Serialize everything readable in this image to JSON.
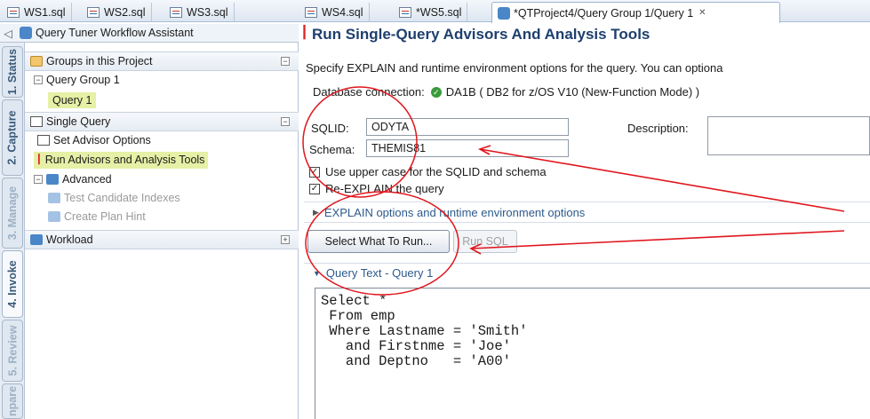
{
  "tabs": [
    {
      "label": "WS1.sql"
    },
    {
      "label": "WS2.sql"
    },
    {
      "label": "WS3.sql"
    },
    {
      "label": "WS4.sql"
    },
    {
      "label": "*WS5.sql"
    },
    {
      "label": "*QTProject4/Query Group 1/Query 1"
    }
  ],
  "side_tabs": [
    "1. Status",
    "2. Capture",
    "3. Manage",
    "4. Invoke",
    "5. Review",
    "npare"
  ],
  "assistant": {
    "title": "Query Tuner Workflow Assistant",
    "groups_section": "Groups in this Project",
    "group_item": "Query Group 1",
    "query_item": "Query 1",
    "single_query_section": "Single Query",
    "set_advisor": "Set Advisor Options",
    "run_advisors": "Run Advisors and Analysis Tools",
    "advanced": "Advanced",
    "test_indexes": "Test Candidate Indexes",
    "plan_hint": "Create Plan Hint",
    "workload": "Workload"
  },
  "main": {
    "title": "Run Single-Query Advisors And Analysis Tools",
    "description": "Specify EXPLAIN and runtime environment options for the query. You can optiona",
    "db_label": "Database connection:",
    "db_value": "DA1B ( DB2 for z/OS V10 (New-Function Mode) )",
    "sqlid_label": "SQLID:",
    "sqlid_value": "ODYTA",
    "description_label": "Description:",
    "schema_label": "Schema:",
    "schema_value": "THEMIS81",
    "chk_upper": "Use upper case for the SQLID and schema",
    "chk_reexplain": "Re-EXPLAIN the query",
    "explain_options": "EXPLAIN options and runtime environment options",
    "btn_select": "Select What To Run...",
    "btn_run": "Run SQL",
    "query_text_header": "Query Text - Query 1",
    "query_text": "Select *\n From emp\n Where Lastname = 'Smith'\n   and Firstnme = 'Joe'\n   and Deptno   = 'A00'"
  },
  "colors": {
    "annotation": "#e0161d",
    "title": "#1e3f6e",
    "highlight": "#e6f0a6"
  }
}
